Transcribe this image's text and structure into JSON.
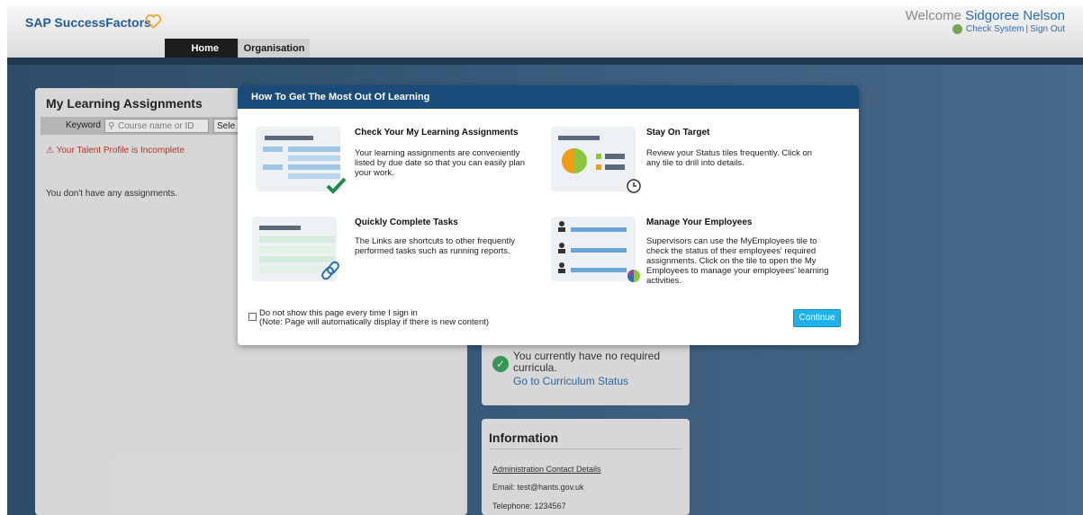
{
  "header": {
    "logo_text": "SAP SuccessFactors",
    "tabs": [
      {
        "label": "Home",
        "active": true
      },
      {
        "label": "Organisation",
        "active": false
      }
    ],
    "welcome_prefix": "Welcome",
    "user_name": "Sidgoree Nelson",
    "check_system": "Check System",
    "separator": "|",
    "sign_out": "Sign Out"
  },
  "learning_panel": {
    "title": "My Learning Assignments",
    "keyword_label": "Keyword",
    "search_placeholder": "Course name or ID",
    "select_label": "Sele",
    "warning": "Your Talent Profile is Incomplete",
    "empty_message": "You don't have any assignments."
  },
  "curricula_panel": {
    "message": "You currently have no required curricula.",
    "link": "Go to Curriculum Status"
  },
  "info_panel": {
    "title": "Information",
    "admin_link": "Administration Contact Details",
    "email": "Email: test@hants.gov.uk",
    "telephone": "Telephone: 1234567"
  },
  "modal": {
    "title": "How To Get The Most Out Of Learning",
    "tips": [
      {
        "title": "Check Your My Learning Assignments",
        "body": "Your learning assignments are conveniently listed by due date so that you can easily plan your work."
      },
      {
        "title": "Stay On Target",
        "body": "Review your Status tiles frequently. Click on any tile to drill into details."
      },
      {
        "title": "Quickly Complete Tasks",
        "body": "The Links are shortcuts to other frequently performed tasks such as running reports."
      },
      {
        "title": "Manage Your Employees",
        "body": "Supervisors can use the MyEmployees tile to check the status of their employees' required assignments. Click on the tile to open the My Employees to manage your employees' learning activities."
      }
    ],
    "checkbox_label": "Do not show this page every time I sign in",
    "checkbox_note": "(Note: Page will automatically display if there is new content)",
    "continue_label": "Continue"
  },
  "colors": {
    "header_blue": "#1a4c7a",
    "accent": "#1fb3ec",
    "link": "#2a6fb2",
    "logo_heart": "#f0a830",
    "warning": "#c0392b"
  }
}
